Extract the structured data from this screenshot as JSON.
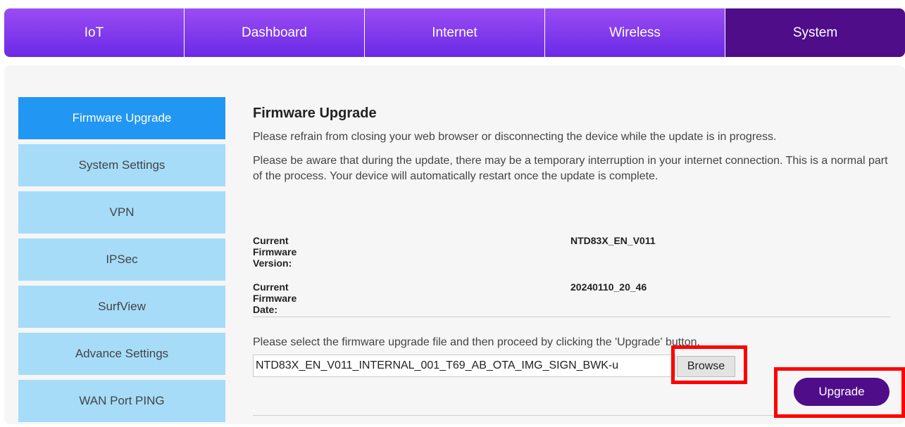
{
  "topnav": {
    "tabs": [
      {
        "label": "IoT"
      },
      {
        "label": "Dashboard"
      },
      {
        "label": "Internet"
      },
      {
        "label": "Wireless"
      },
      {
        "label": "System",
        "active": true
      }
    ]
  },
  "sidebar": {
    "items": [
      {
        "label": "Firmware Upgrade",
        "active": true
      },
      {
        "label": "System Settings"
      },
      {
        "label": "VPN"
      },
      {
        "label": "IPSec"
      },
      {
        "label": "SurfView"
      },
      {
        "label": "Advance Settings"
      },
      {
        "label": "WAN Port PING"
      }
    ]
  },
  "main": {
    "title": "Firmware Upgrade",
    "notice1": "Please refrain from closing your web browser or disconnecting the device while the update is in progress.",
    "notice2": "Please be aware that during the update, there may be a temporary interruption in your internet connection. This is a normal part of the process. Your device will automatically restart once the update is complete.",
    "version_label": "Current Firmware Version:",
    "version_value": "NTD83X_EN_V011",
    "date_label": "Current Firmware Date:",
    "date_value": "20240110_20_46",
    "select_instruction": "Please select the firmware upgrade file and then proceed by clicking the 'Upgrade' button.",
    "file_value": "NTD83X_EN_V011_INTERNAL_001_T69_AB_OTA_IMG_SIGN_BWK-u",
    "browse_label": "Browse",
    "upgrade_label": "Upgrade"
  },
  "colors": {
    "tab_gradient_top": "#9b4cf3",
    "tab_active": "#4f0d8a",
    "sidebar_active": "#2296f3",
    "sidebar_item": "#a6dcf8",
    "highlight": "#ff0000"
  }
}
